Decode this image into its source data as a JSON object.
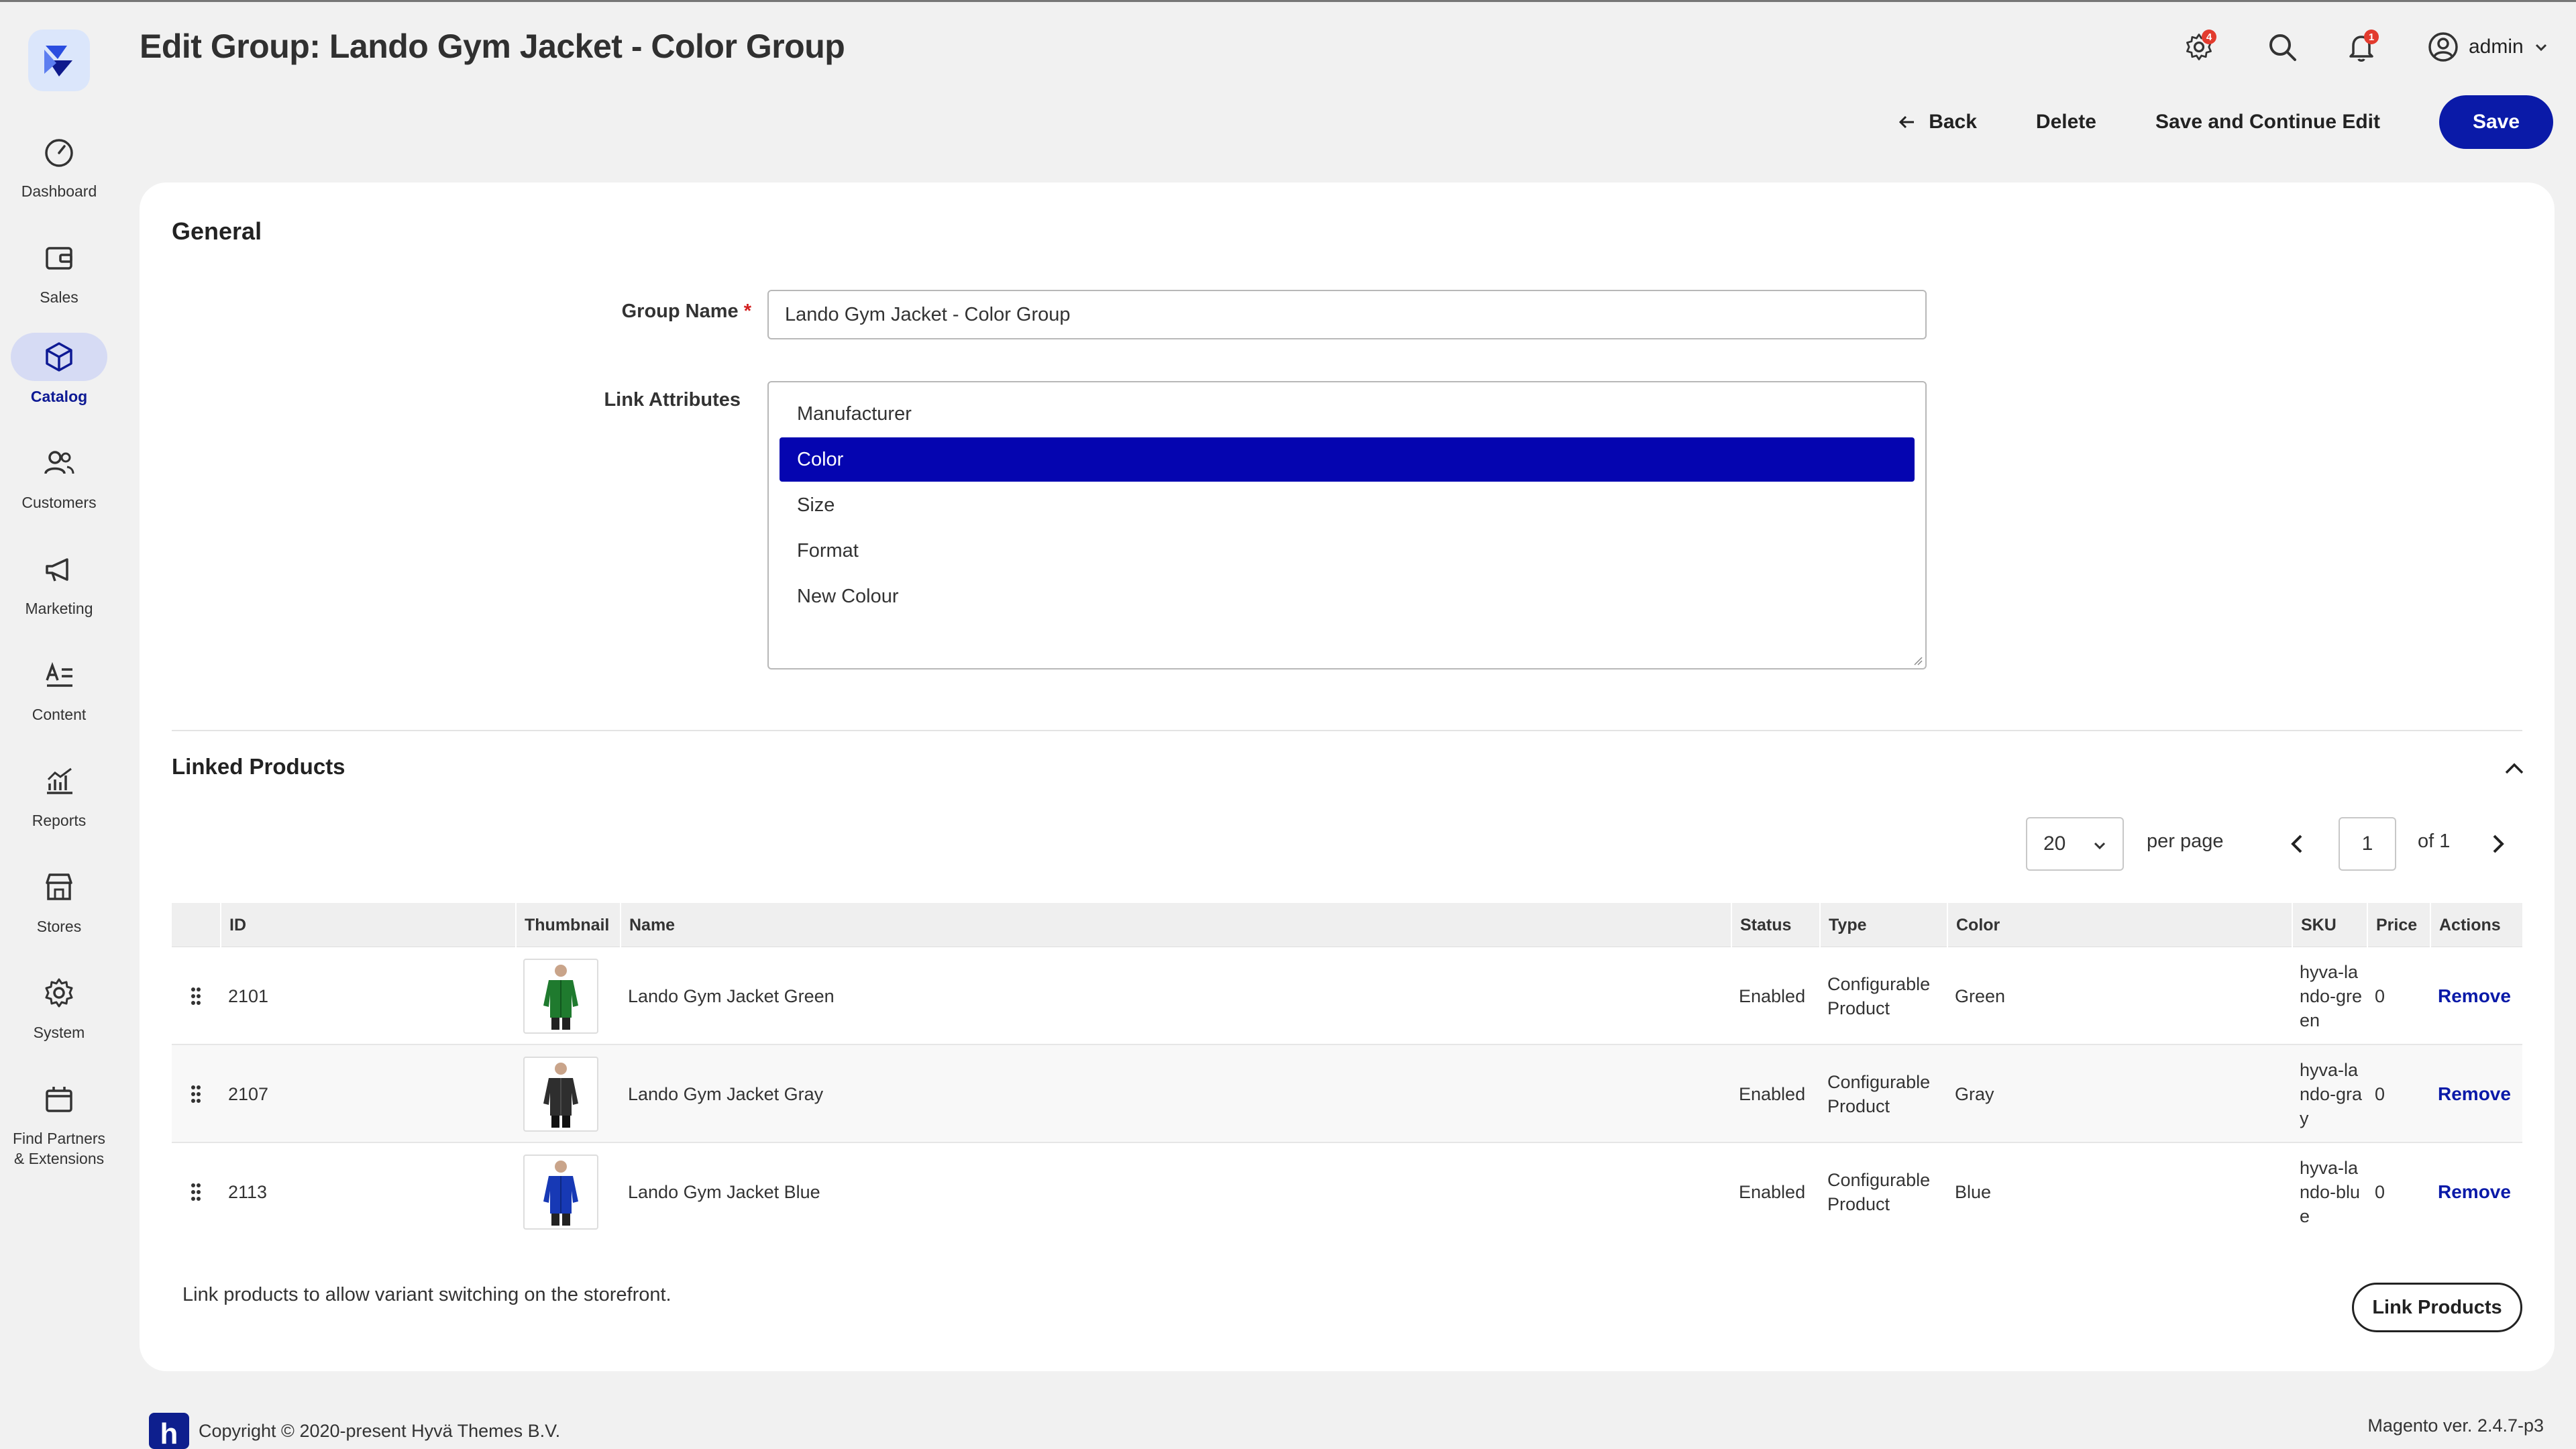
{
  "header": {
    "title": "Edit Group: Lando Gym Jacket - Color Group",
    "system_messages_count": "4",
    "notifications_count": "1",
    "user_name": "admin"
  },
  "actions": {
    "back": "Back",
    "delete": "Delete",
    "save_continue": "Save and Continue Edit",
    "save": "Save"
  },
  "sidebar": {
    "items": [
      {
        "label": "Dashboard",
        "icon": "dashboard-gauge-icon"
      },
      {
        "label": "Sales",
        "icon": "wallet-icon"
      },
      {
        "label": "Catalog",
        "icon": "cube-icon",
        "active": true
      },
      {
        "label": "Customers",
        "icon": "users-icon"
      },
      {
        "label": "Marketing",
        "icon": "megaphone-icon"
      },
      {
        "label": "Content",
        "icon": "text-lines-icon"
      },
      {
        "label": "Reports",
        "icon": "chart-icon"
      },
      {
        "label": "Stores",
        "icon": "storefront-icon"
      },
      {
        "label": "System",
        "icon": "gear-icon"
      },
      {
        "label": "Find Partners & Extensions",
        "icon": "box-icon"
      }
    ]
  },
  "general": {
    "section_title": "General",
    "group_name_label": "Group Name",
    "group_name_value": "Lando Gym Jacket - Color Group",
    "link_attributes_label": "Link Attributes",
    "link_attributes_options": [
      "Manufacturer",
      "Color",
      "Size",
      "Format",
      "New Colour"
    ],
    "link_attributes_selected": "Color"
  },
  "linked_products": {
    "section_title": "Linked Products",
    "page_size": "20",
    "per_page_label": "per page",
    "current_page": "1",
    "total_pages_label": "of 1",
    "columns": [
      "ID",
      "Thumbnail",
      "Name",
      "Status",
      "Type",
      "Color",
      "SKU",
      "Price",
      "Actions"
    ],
    "rows": [
      {
        "id": "2101",
        "name": "Lando Gym Jacket Green",
        "status": "Enabled",
        "type": "Configurable Product",
        "color": "Green",
        "sku": "hyva-lando-green",
        "price": "0",
        "action": "Remove",
        "swatch": "#1f7a2e"
      },
      {
        "id": "2107",
        "name": "Lando Gym Jacket Gray",
        "status": "Enabled",
        "type": "Configurable Product",
        "color": "Gray",
        "sku": "hyva-lando-gray",
        "price": "0",
        "action": "Remove",
        "swatch": "#2e2e2e"
      },
      {
        "id": "2113",
        "name": "Lando Gym Jacket Blue",
        "status": "Enabled",
        "type": "Configurable Product",
        "color": "Blue",
        "sku": "hyva-lando-blue",
        "price": "0",
        "action": "Remove",
        "swatch": "#1739b5"
      }
    ],
    "hint": "Link products to allow variant switching on the storefront.",
    "link_button": "Link Products"
  },
  "footer": {
    "logo_letter": "h",
    "copyright": "Copyright © 2020-present Hyvä Themes B.V.",
    "version": "Magento ver. 2.4.7-p3"
  },
  "colors": {
    "accent": "#0a1aa8",
    "selected_option": "#0505b0",
    "badge": "#e23b2e"
  }
}
